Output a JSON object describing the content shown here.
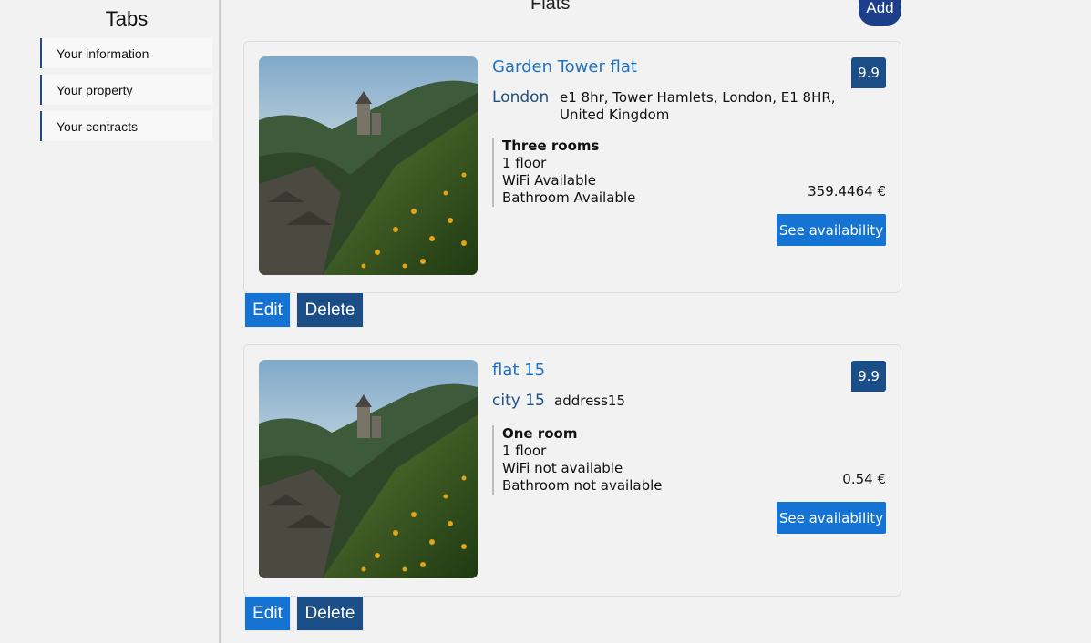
{
  "sidebar": {
    "title": "Tabs",
    "items": [
      {
        "label": "Your information"
      },
      {
        "label": "Your property"
      },
      {
        "label": "Your contracts"
      }
    ]
  },
  "header": {
    "title": "Flats",
    "add_label": "Add"
  },
  "flats": [
    {
      "name": "Garden Tower flat",
      "rating": "9.9",
      "city": "London",
      "address": "e1 8hr, Tower Hamlets, London, E1 8HR, United Kingdom",
      "rooms": "Three rooms",
      "floor": "1 floor",
      "wifi": "WiFi Available",
      "bathroom": "Bathroom Available",
      "price": "359.4464 €",
      "availability_label": "See availability",
      "edit_label": "Edit",
      "delete_label": "Delete"
    },
    {
      "name": "flat 15",
      "rating": "9.9",
      "city": "city 15",
      "address": "address15",
      "rooms": "One room",
      "floor": "1 floor",
      "wifi": "WiFi not available",
      "bathroom": "Bathroom not available",
      "price": "0.54 €",
      "availability_label": "See availability",
      "edit_label": "Edit",
      "delete_label": "Delete"
    }
  ],
  "colors": {
    "accent": "#1473d3",
    "dark_accent": "#1b4d86",
    "link": "#1e73c0"
  }
}
